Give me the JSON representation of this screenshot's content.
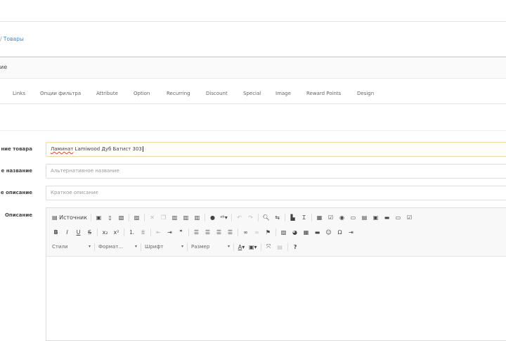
{
  "breadcrumb": {
    "sep": "/",
    "item": "Товары"
  },
  "panel": {
    "title": "ие"
  },
  "tabs": [
    "Links",
    "Опции фильтра",
    "Attribute",
    "Option",
    "Recurring",
    "Discount",
    "Special",
    "Image",
    "Reward Points",
    "Design"
  ],
  "form": {
    "name_label": "ние товара",
    "name_value_misspelled": "Ламинат",
    "name_value_rest": " Lamiwood Дуб Батист 303",
    "alt_label": "е название",
    "alt_placeholder": "Альтернативное название",
    "short_label": "е описание",
    "short_placeholder": "Краткое описание",
    "desc_label": "Описание"
  },
  "editor": {
    "source_label": "Источник",
    "styles": "Стили",
    "format": "Формат...",
    "font": "Шрифт",
    "size": "Размер",
    "help": "?"
  }
}
